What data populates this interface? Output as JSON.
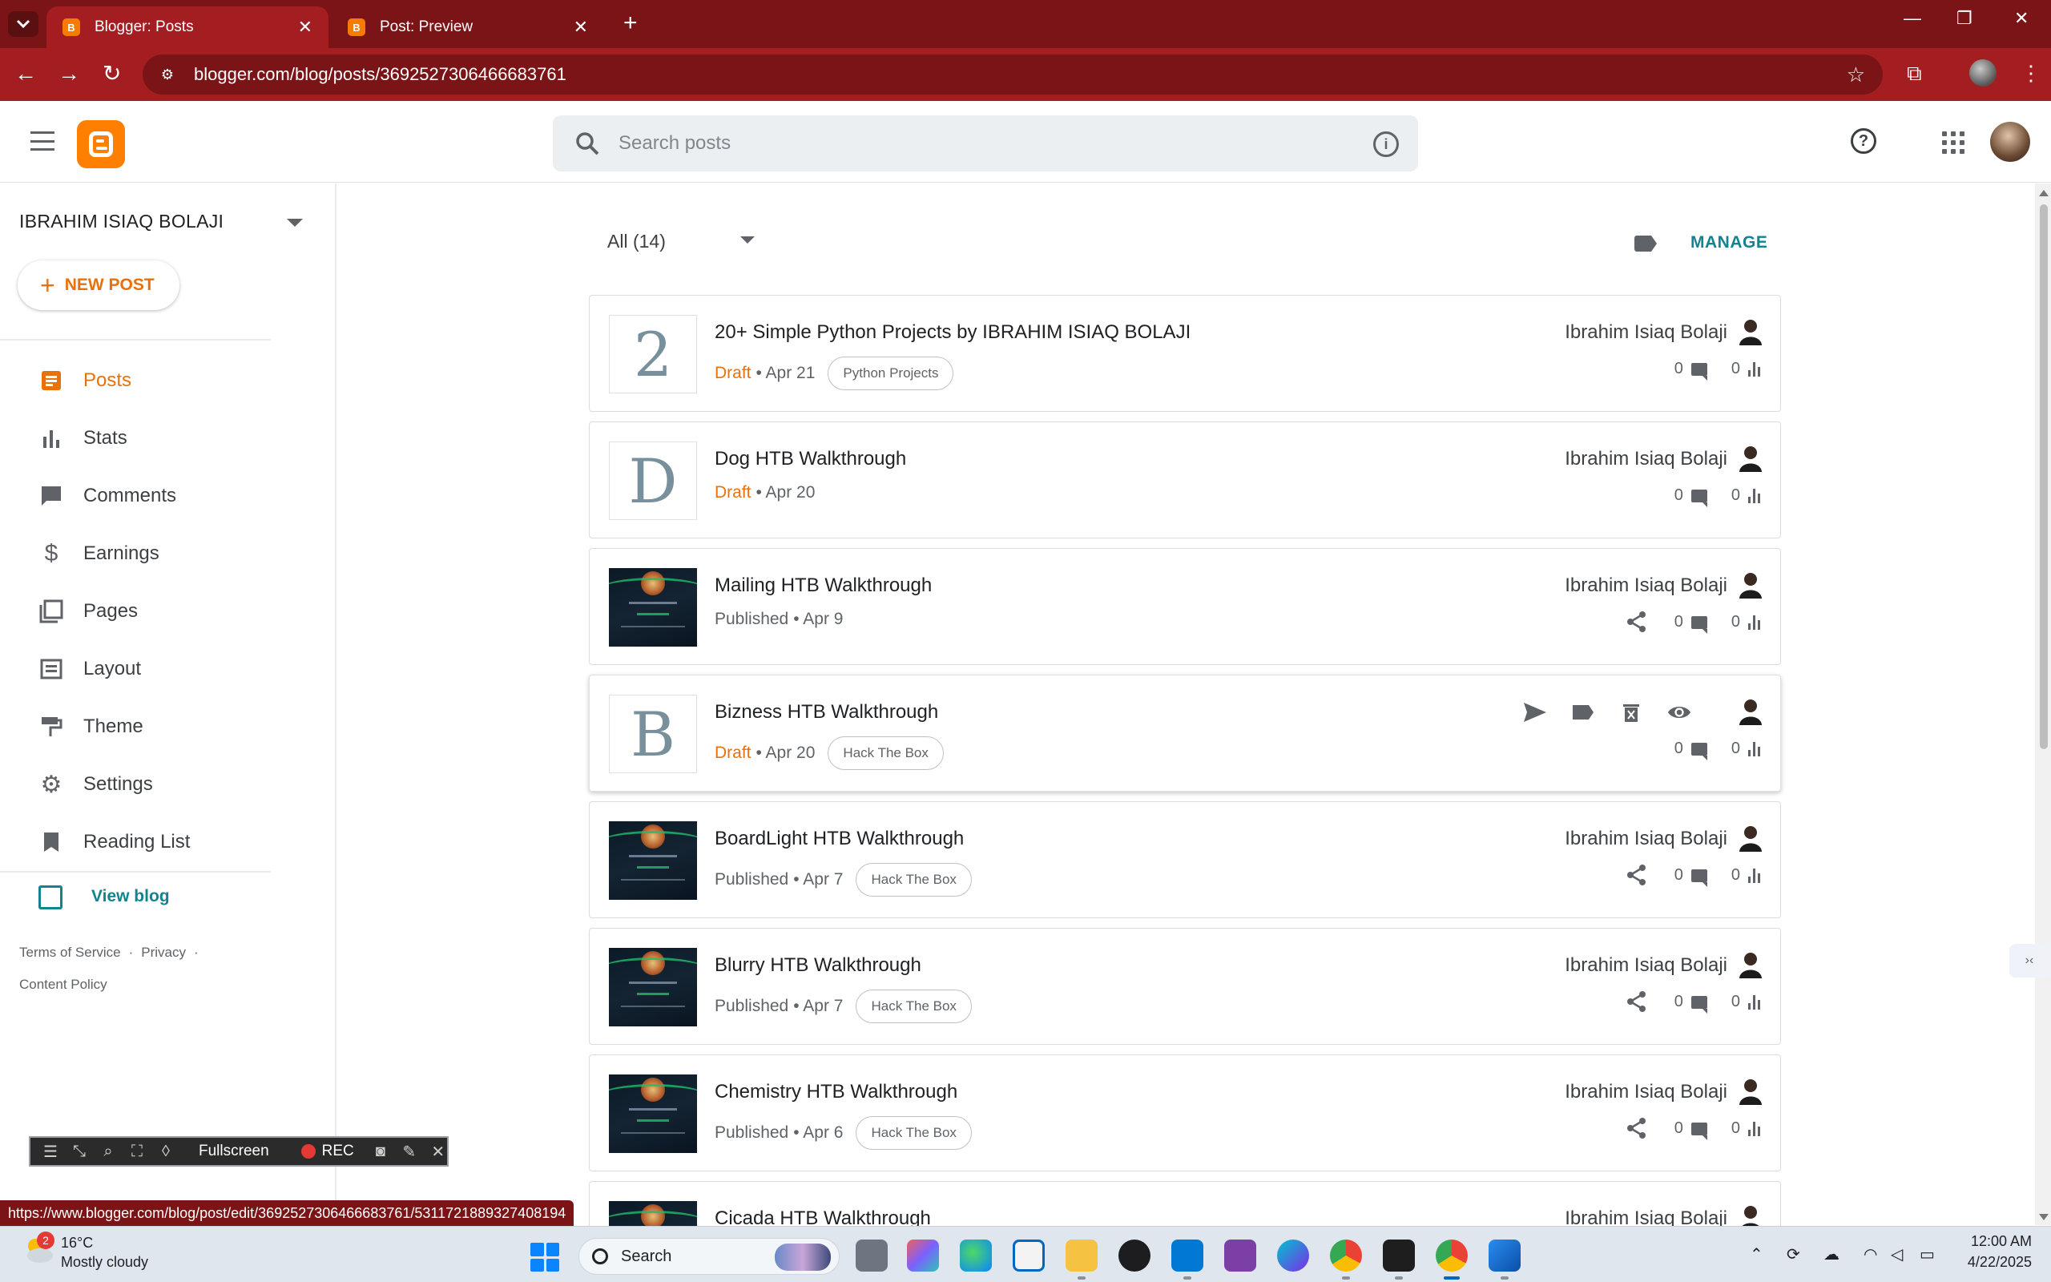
{
  "browser": {
    "tabs": [
      {
        "title": "Blogger: Posts",
        "active": true
      },
      {
        "title": "Post: Preview",
        "active": false
      }
    ],
    "url": "blogger.com/blog/posts/3692527306466683761",
    "status_url": "https://www.blogger.com/blog/post/edit/3692527306466683761/5311721889327408194"
  },
  "header": {
    "search_placeholder": "Search posts"
  },
  "sidebar": {
    "blog_name": "IBRAHIM ISIAQ BOLAJI",
    "new_post_label": "NEW POST",
    "items": [
      {
        "label": "Posts",
        "icon": "posts-icon",
        "active": true
      },
      {
        "label": "Stats",
        "icon": "stats-icon",
        "active": false
      },
      {
        "label": "Comments",
        "icon": "comments-icon",
        "active": false
      },
      {
        "label": "Earnings",
        "icon": "dollar-icon",
        "active": false
      },
      {
        "label": "Pages",
        "icon": "pages-icon",
        "active": false
      },
      {
        "label": "Layout",
        "icon": "layout-icon",
        "active": false
      },
      {
        "label": "Theme",
        "icon": "paint-roller-icon",
        "active": false
      },
      {
        "label": "Settings",
        "icon": "gear-icon",
        "active": false
      },
      {
        "label": "Reading List",
        "icon": "bookmark-icon",
        "active": false
      }
    ],
    "view_blog_label": "View blog",
    "footer": {
      "terms": "Terms of Service",
      "privacy": "Privacy",
      "content_policy": "Content Policy",
      "separator": "·"
    }
  },
  "main": {
    "filter_label": "All (14)",
    "manage_label": "MANAGE",
    "posts": [
      {
        "thumb_letter": "2",
        "thumb_type": "letter",
        "title": "20+ Simple Python Projects by IBRAHIM ISIAQ BOLAJI",
        "status": "Draft",
        "date": "• Apr 21",
        "tag": "Python Projects",
        "author": "Ibrahim Isiaq Bolaji",
        "comments": "0",
        "views": "0",
        "shareable": false
      },
      {
        "thumb_letter": "D",
        "thumb_type": "letter",
        "title": "Dog HTB Walkthrough",
        "status": "Draft",
        "date": "• Apr 20",
        "tag": "",
        "author": "Ibrahim Isiaq Bolaji",
        "comments": "0",
        "views": "0",
        "shareable": false
      },
      {
        "thumb_letter": "",
        "thumb_type": "image",
        "title": "Mailing HTB Walkthrough",
        "status": "Published",
        "date": "• Apr 9",
        "tag": "",
        "author": "Ibrahim Isiaq Bolaji",
        "comments": "0",
        "views": "0",
        "shareable": true
      },
      {
        "thumb_letter": "B",
        "thumb_type": "letter",
        "title": "Bizness HTB Walkthrough",
        "status": "Draft",
        "date": "• Apr 20",
        "tag": "Hack The Box",
        "author": "",
        "comments": "0",
        "views": "0",
        "shareable": false,
        "hovered": true
      },
      {
        "thumb_letter": "",
        "thumb_type": "image",
        "title": "BoardLight HTB Walkthrough",
        "status": "Published",
        "date": "• Apr 7",
        "tag": "Hack The Box",
        "author": "Ibrahim Isiaq Bolaji",
        "comments": "0",
        "views": "0",
        "shareable": true
      },
      {
        "thumb_letter": "",
        "thumb_type": "image",
        "title": "Blurry HTB Walkthrough",
        "status": "Published",
        "date": "• Apr 7",
        "tag": "Hack The Box",
        "author": "Ibrahim Isiaq Bolaji",
        "comments": "0",
        "views": "0",
        "shareable": true
      },
      {
        "thumb_letter": "",
        "thumb_type": "image",
        "title": "Chemistry HTB Walkthrough",
        "status": "Published",
        "date": "• Apr 6",
        "tag": "Hack The Box",
        "author": "Ibrahim Isiaq Bolaji",
        "comments": "0",
        "views": "0",
        "shareable": true
      },
      {
        "thumb_letter": "",
        "thumb_type": "image",
        "title": "Cicada HTB Walkthrough",
        "status": "",
        "date": "",
        "tag": "",
        "author": "Ibrahim Isiaq Bolaji",
        "comments": "",
        "views": "",
        "shareable": false
      }
    ]
  },
  "recorder": {
    "fullscreen_label": "Fullscreen",
    "rec_label": "REC"
  },
  "taskbar": {
    "weather_badge": "2",
    "temperature": "16°C",
    "weather_desc": "Mostly cloudy",
    "search_label": "Search",
    "time": "12:00 AM",
    "date": "4/22/2025"
  },
  "colors": {
    "chrome_dark": "#7b1416",
    "chrome_toolbar": "#a41d21",
    "blogger_orange": "#ff8000",
    "accent_orange_text": "#e8710a",
    "teal_link": "#12838f"
  }
}
